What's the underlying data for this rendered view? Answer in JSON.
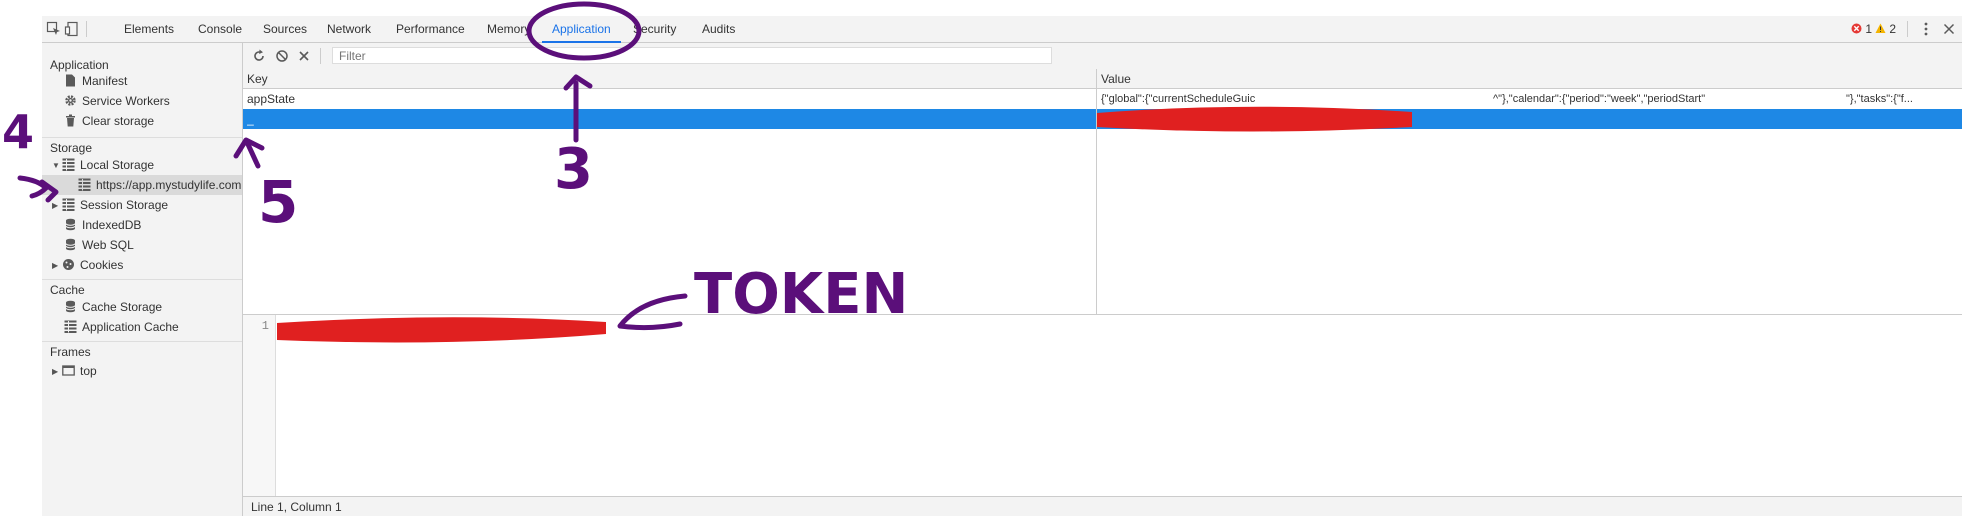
{
  "tabs": [
    {
      "label": "Elements",
      "active": false
    },
    {
      "label": "Console",
      "active": false
    },
    {
      "label": "Sources",
      "active": false
    },
    {
      "label": "Network",
      "active": false
    },
    {
      "label": "Performance",
      "active": false
    },
    {
      "label": "Memory",
      "active": false
    },
    {
      "label": "Application",
      "active": true
    },
    {
      "label": "Security",
      "active": false
    },
    {
      "label": "Audits",
      "active": false
    }
  ],
  "counters": {
    "errors": "1",
    "warnings": "2",
    "error_color": "#e53935",
    "warning_color": "#f4b400"
  },
  "sidebar": {
    "application": {
      "title": "Application",
      "items": [
        {
          "label": "Manifest",
          "icon": "document-icon"
        },
        {
          "label": "Service Workers",
          "icon": "gear-icon"
        },
        {
          "label": "Clear storage",
          "icon": "trash-icon"
        }
      ]
    },
    "storage": {
      "title": "Storage",
      "items": [
        {
          "label": "Local Storage",
          "icon": "grid-icon",
          "expanded": true
        },
        {
          "label": "https://app.mystudylife.com",
          "icon": "grid-icon",
          "selected": true
        },
        {
          "label": "Session Storage",
          "icon": "grid-icon",
          "expanded": false
        },
        {
          "label": "IndexedDB",
          "icon": "database-icon"
        },
        {
          "label": "Web SQL",
          "icon": "database-icon"
        },
        {
          "label": "Cookies",
          "icon": "cookie-icon",
          "expanded": false
        }
      ]
    },
    "cache": {
      "title": "Cache",
      "items": [
        {
          "label": "Cache Storage",
          "icon": "database-icon"
        },
        {
          "label": "Application Cache",
          "icon": "grid-icon"
        }
      ]
    },
    "frames": {
      "title": "Frames",
      "items": [
        {
          "label": "top",
          "icon": "frame-icon",
          "expanded": false
        }
      ]
    }
  },
  "toolbar": {
    "filter_placeholder": "Filter"
  },
  "table": {
    "columns": [
      "Key",
      "Value"
    ],
    "rows": [
      {
        "key": "appState",
        "value_part1": "{\"global\":{\"currentScheduleGuic",
        "value_part2": "^\"},\"calendar\":{\"period\":\"week\",\"periodStart\"",
        "value_part3": "\"},\"tasks\":{\"f...",
        "selected": false
      },
      {
        "key": "_",
        "value": "",
        "selected": true
      }
    ],
    "selected_row_color": "#1e88e5"
  },
  "editor": {
    "line_number": "1"
  },
  "statusbar": {
    "text": "Line 1, Column 1"
  },
  "annotations": {
    "label_3": "3",
    "label_4": "4",
    "label_5": "5",
    "label_token": "TOKEN",
    "ink_color": "#5b0f7a",
    "redaction_color": "#e02020"
  }
}
